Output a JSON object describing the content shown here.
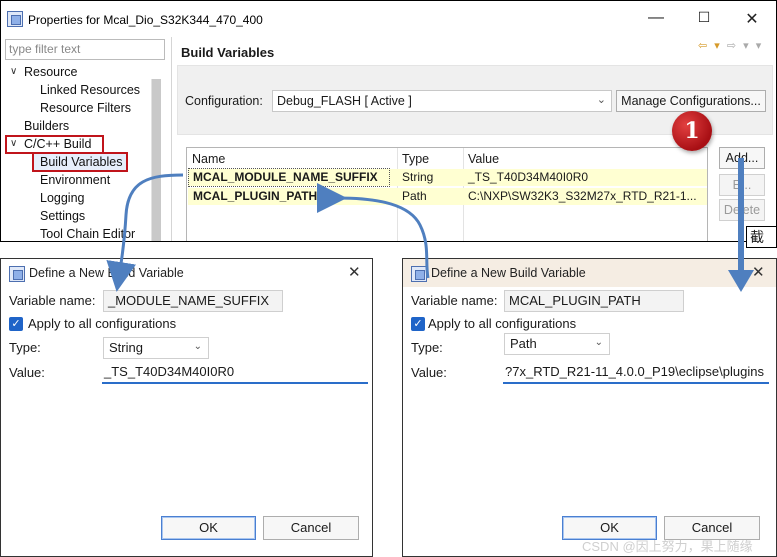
{
  "main_window": {
    "title": "Properties for Mcal_Dio_S32K344_470_400",
    "minimize": "—",
    "maximize": "☐",
    "close": "✕",
    "filter_placeholder": "type filter text",
    "page_title": "Build Variables",
    "tree": [
      {
        "label": "Resource",
        "expanded": true
      },
      {
        "label": "Linked Resources"
      },
      {
        "label": "Resource Filters"
      },
      {
        "label": "Builders"
      },
      {
        "label": "C/C++ Build",
        "expanded": true
      },
      {
        "label": "Build Variables",
        "selected": true
      },
      {
        "label": "Environment"
      },
      {
        "label": "Logging"
      },
      {
        "label": "Settings"
      },
      {
        "label": "Tool Chain Editor"
      }
    ],
    "configuration_label": "Configuration:",
    "configuration_value": "Debug_FLASH  [ Active ]",
    "manage_button": "Manage Configurations...",
    "table_headers": [
      "Name",
      "Type",
      "Value"
    ],
    "variables": [
      {
        "name": "MCAL_MODULE_NAME_SUFFIX",
        "type": "String",
        "value": "_TS_T40D34M40I0R0"
      },
      {
        "name": "MCAL_PLUGIN_PATH",
        "type": "Path",
        "value": "C:\\NXP\\SW32K3_S32M27x_RTD_R21-1..."
      }
    ],
    "buttons": {
      "add": "Add...",
      "edit": "E...",
      "delete": "Delete"
    }
  },
  "annotation_badge": "1",
  "screenshot_tag": "截图",
  "dialog_left": {
    "title": "Define a New Build Variable",
    "close": "✕",
    "name_label": "Variable name:",
    "name_value": "_MODULE_NAME_SUFFIX",
    "apply_all_label": "Apply to all configurations",
    "apply_all_checked": true,
    "type_label": "Type:",
    "type_value": "String",
    "value_label": "Value:",
    "value_value": "_TS_T40D34M40I0R0",
    "ok": "OK",
    "cancel": "Cancel"
  },
  "dialog_right": {
    "title": "Define a New Build Variable",
    "close": "✕",
    "name_label": "Variable name:",
    "name_value": "MCAL_PLUGIN_PATH",
    "apply_all_label": "Apply to all configurations",
    "apply_all_checked": true,
    "type_label": "Type:",
    "type_value": "Path",
    "value_label": "Value:",
    "value_value": "?7x_RTD_R21-11_4.0.0_P19\\eclipse\\plugins",
    "ok": "OK",
    "cancel": "Cancel"
  },
  "watermark": "CSDN @因上努力，果上随缘",
  "colors": {
    "highlight_box": "#c0141b",
    "arrow": "#4f7fbf",
    "row_bg": "#ffffd2",
    "badge": "#c41a1f"
  }
}
